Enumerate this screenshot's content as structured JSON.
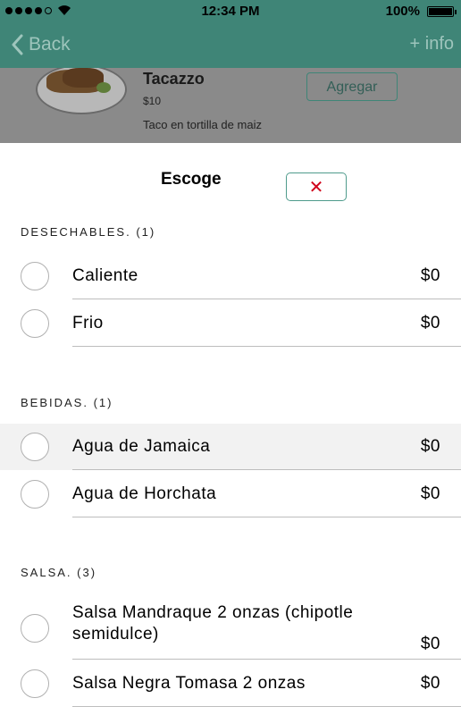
{
  "statusbar": {
    "time": "12:34 PM",
    "battery": "100%"
  },
  "navbar": {
    "back_label": "Back",
    "info_label": "+ info"
  },
  "product": {
    "name": "Tacazzo",
    "price": "$10",
    "description": "Taco en tortilla de maiz",
    "add_label": "Agregar"
  },
  "sheet": {
    "title": "Escoge",
    "close_symbol": "✕",
    "sections": [
      {
        "header": "DESECHABLES. (1)",
        "options": [
          {
            "label": "Caliente",
            "price": "$0"
          },
          {
            "label": "Frio",
            "price": "$0"
          }
        ]
      },
      {
        "header": "BEBIDAS. (1)",
        "options": [
          {
            "label": "Agua de Jamaica",
            "price": "$0"
          },
          {
            "label": "Agua de Horchata",
            "price": "$0"
          }
        ]
      },
      {
        "header": "SALSA. (3)",
        "options": [
          {
            "label": "Salsa Mandraque 2 onzas (chipotle semidulce)",
            "price": "$0"
          },
          {
            "label": "Salsa Negra Tomasa 2 onzas",
            "price": "$0"
          }
        ]
      }
    ]
  },
  "colors": {
    "accent": "#3f8577",
    "close_x": "#d0021b",
    "highlight": "#f2f2f2"
  }
}
